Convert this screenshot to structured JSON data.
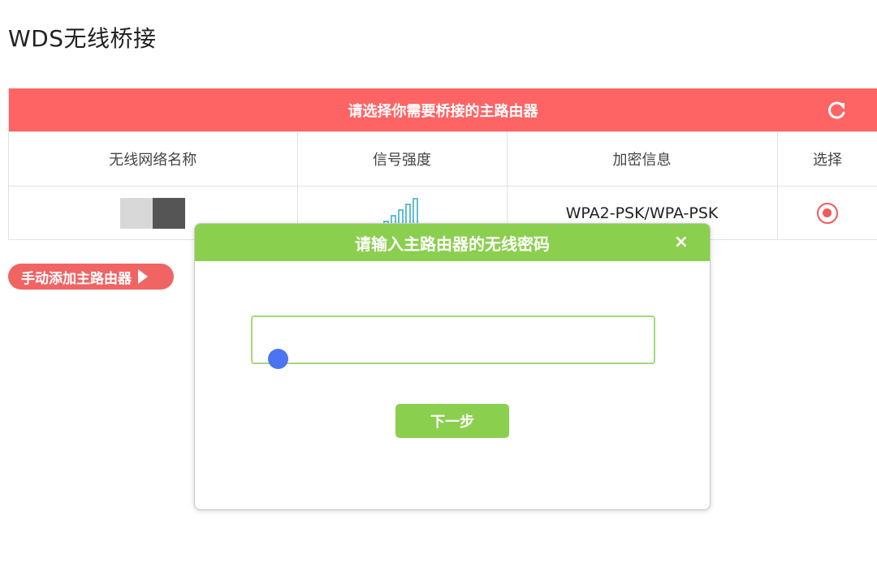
{
  "page": {
    "title": "WDS无线桥接"
  },
  "panel": {
    "header": "请选择你需要桥接的主路由器",
    "columns": [
      "无线网络名称",
      "信号强度",
      "加密信息",
      "选择"
    ],
    "rows": [
      {
        "ssid": "",
        "signal_bars": 4,
        "signal_max": 5,
        "encryption": "WPA2-PSK/WPA-PSK",
        "selected": true
      }
    ]
  },
  "manual_add": {
    "label": "手动添加主路由器"
  },
  "dialog": {
    "title": "请输入主路由器的无线密码",
    "close": "×",
    "password_value": "",
    "next_label": "下一步"
  },
  "colors": {
    "header_red": "#ff6464",
    "accent_green": "#8bcf4e",
    "signal_teal": "#4fb9cc",
    "cursor_blue": "#4b74f0"
  },
  "icons": {
    "refresh": "refresh-icon",
    "radio": "radio-selected-icon",
    "arrow": "play-arrow-icon",
    "close": "close-icon",
    "signal": "signal-strength-icon"
  }
}
